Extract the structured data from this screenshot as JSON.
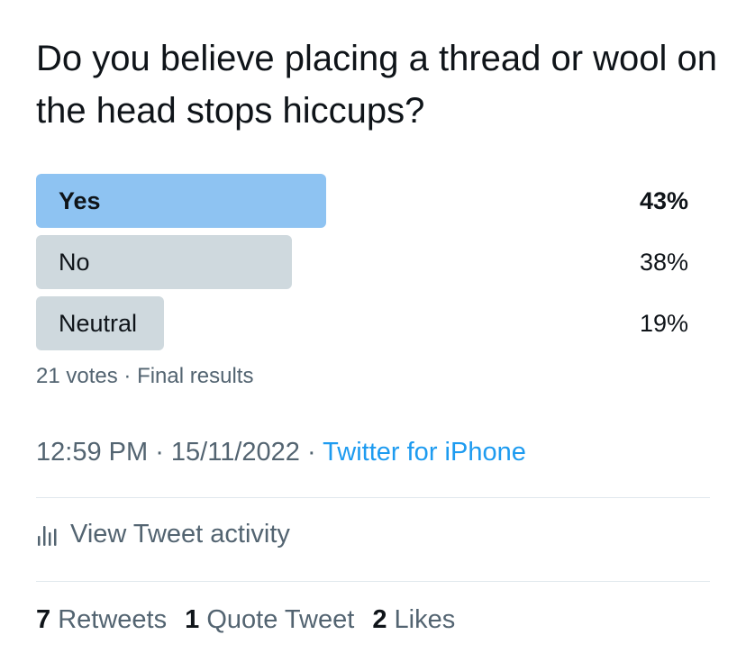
{
  "tweet": {
    "text": "Do you believe placing a thread or wool on the head stops hiccups?"
  },
  "poll": {
    "options": [
      {
        "label": "Yes",
        "percent": "43%",
        "fraction": 0.43,
        "winner": true
      },
      {
        "label": "No",
        "percent": "38%",
        "fraction": 0.38,
        "winner": false
      },
      {
        "label": "Neutral",
        "percent": "19%",
        "fraction": 0.19,
        "winner": false
      }
    ],
    "votes": "21 votes",
    "separator": " · ",
    "status": "Final results",
    "winner_color": "#8ec3f2",
    "bar_color": "#cfd9de"
  },
  "meta": {
    "time": "12:59 PM",
    "separator": " · ",
    "date": "15/11/2022",
    "source": "Twitter for iPhone",
    "source_color": "#1d9bf0"
  },
  "activity": {
    "icon": "bar-chart-icon",
    "label": "View Tweet activity"
  },
  "engagement": {
    "retweets_count": "7",
    "retweets_label": "Retweets",
    "quotes_count": "1",
    "quotes_label": "Quote Tweet",
    "likes_count": "2",
    "likes_label": "Likes"
  }
}
